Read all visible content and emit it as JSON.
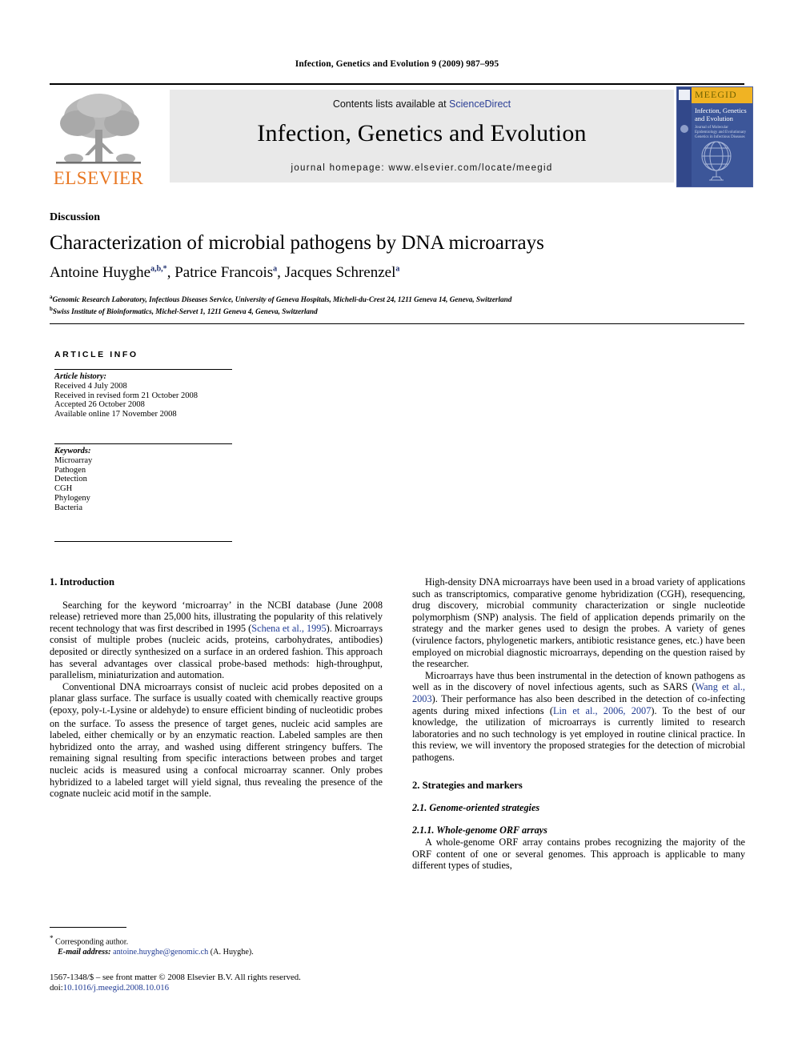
{
  "running_head": "Infection, Genetics and Evolution 9 (2009) 987–995",
  "masthead": {
    "publisher_name": "ELSEVIER",
    "contents_prefix": "Contents lists available at ",
    "contents_link": "ScienceDirect",
    "journal_title": "Infection, Genetics and Evolution",
    "homepage": "journal homepage: www.elsevier.com/locate/meegid",
    "cover": {
      "banner": "MEEGID",
      "title": "Infection, Genetics and Evolution",
      "subtitle": "Journal of Molecular Epidemiology and Evolutionary Genetics in Infectious Diseases"
    }
  },
  "article": {
    "doctype": "Discussion",
    "title": "Characterization of microbial pathogens by DNA microarrays",
    "authors": [
      {
        "name": "Antoine Huyghe",
        "sup": "a,b,*"
      },
      {
        "name": "Patrice Francois",
        "sup": "a"
      },
      {
        "name": "Jacques Schrenzel",
        "sup": "a"
      }
    ],
    "affiliations": [
      {
        "mark": "a",
        "text": "Genomic Research Laboratory, Infectious Diseases Service, University of Geneva Hospitals, Micheli-du-Crest 24, 1211 Geneva 14, Geneva, Switzerland"
      },
      {
        "mark": "b",
        "text": "Swiss Institute of Bioinformatics, Michel-Servet 1, 1211 Geneva 4, Geneva, Switzerland"
      }
    ]
  },
  "info": {
    "label": "ARTICLE INFO",
    "history_header": "Article history:",
    "history": [
      "Received 4 July 2008",
      "Received in revised form 21 October 2008",
      "Accepted 26 October 2008",
      "Available online 17 November 2008"
    ],
    "keywords_header": "Keywords:",
    "keywords": [
      "Microarray",
      "Pathogen",
      "Detection",
      "CGH",
      "Phylogeny",
      "Bacteria"
    ]
  },
  "body": {
    "intro_heading": "1. Introduction",
    "intro_p1_a": "Searching for the keyword ‘microarray’ in the NCBI database (June 2008 release) retrieved more than 25,000 hits, illustrating the popularity of this relatively recent technology that was first described in 1995 (",
    "intro_p1_cite": "Schena et al., 1995",
    "intro_p1_b": "). Microarrays consist of multiple probes (nucleic acids, proteins, carbohydrates, antibodies) deposited or directly synthesized on a surface in an ordered fashion. This approach has several advantages over classical probe-based methods: high-throughput, parallelism, miniaturization and automation.",
    "intro_p2_a": "Conventional DNA microarrays consist of nucleic acid probes deposited on a planar glass surface. The surface is usually coated with chemically reactive groups (epoxy, poly-",
    "intro_p2_smallcap": "l",
    "intro_p2_b": "-Lysine or aldehyde) to ensure efficient binding of nucleotidic probes on the surface. To assess the presence of target genes, nucleic acid samples are labeled, either chemically or by an enzymatic reaction. Labeled samples are then hybridized onto the array, and washed using different stringency buffers. The remaining signal resulting from specific interactions between probes and target nucleic acids is measured using a confocal microarray scanner. Only probes hybridized to a labeled target will yield signal, thus revealing the presence of the cognate nucleic acid motif in the sample.",
    "right_p1": "High-density DNA microarrays have been used in a broad variety of applications such as transcriptomics, comparative genome hybridization (CGH), resequencing, drug discovery, microbial community characterization or single nucleotide polymorphism (SNP) analysis. The field of application depends primarily on the strategy and the marker genes used to design the probes. A variety of genes (virulence factors, phylogenetic markers, antibiotic resistance genes, etc.) have been employed on microbial diagnostic microarrays, depending on the question raised by the researcher.",
    "right_p2_a": "Microarrays have thus been instrumental in the detection of known pathogens as well as in the discovery of novel infectious agents, such as SARS (",
    "right_p2_cite1": "Wang et al., 2003",
    "right_p2_b": "). Their performance has also been described in the detection of co-infecting agents during mixed infections (",
    "right_p2_cite2": "Lin et al., 2006, 2007",
    "right_p2_c": "). To the best of our knowledge, the utilization of microarrays is currently limited to research laboratories and no such technology is yet employed in routine clinical practice. In this review, we will inventory the proposed strategies for the detection of microbial pathogens.",
    "h2_strategies": "2. Strategies and markers",
    "h3_genome": "2.1. Genome-oriented strategies",
    "h4_orf": "2.1.1. Whole-genome ORF arrays",
    "orf_p": "A whole-genome ORF array contains probes recognizing the majority of the ORF content of one or several genomes. This approach is applicable to many different types of studies,"
  },
  "footer": {
    "corresponding_star": "*",
    "corresponding_label": "Corresponding author.",
    "email_label": "E-mail address:",
    "email": "antoine.huyghe@genomic.ch",
    "email_suffix": " (A. Huyghe).",
    "copyright": "1567-1348/$ – see front matter © 2008 Elsevier B.V. All rights reserved.",
    "doi_label": "doi:",
    "doi": "10.1016/j.meegid.2008.10.016"
  },
  "colors": {
    "link": "#1f3a93",
    "sciencedirect": "#2b3f96",
    "elsevier_orange": "#e87722",
    "panel_grey": "#e9e9e9",
    "cover_blue": "#3c5699",
    "cover_yellow": "#f0b323"
  }
}
